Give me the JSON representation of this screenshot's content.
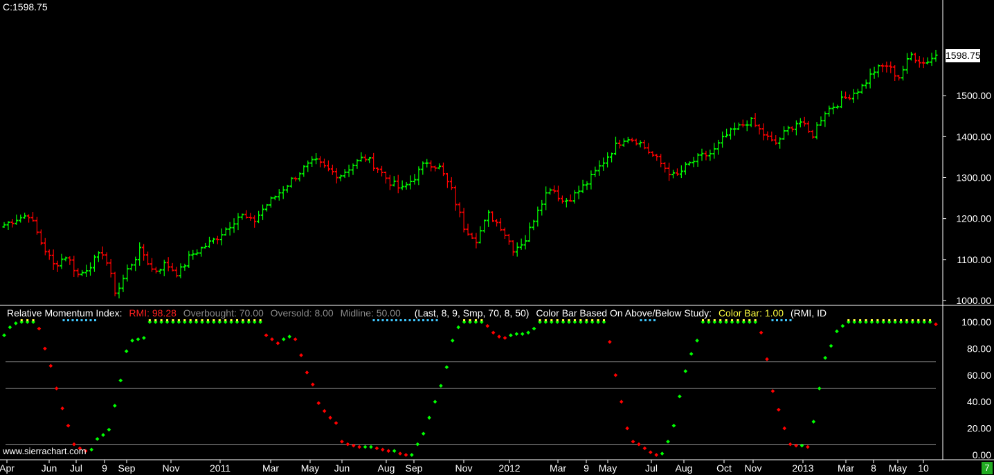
{
  "header": {
    "close_label": "C:1598.75"
  },
  "watermark": "www.sierrachart.com",
  "last_price_label": "1598.75",
  "corner_badge": "7",
  "study_header": {
    "name": "Relative Momentum Index:",
    "rmi": "RMI: 98.28",
    "overbought": "Overbought: 70.00",
    "oversold": "Oversold: 8.00",
    "midline": "Midline: 50.00",
    "params": "(Last, 8, 9, Smp, 70, 8, 50)",
    "color_bar_desc": "Color Bar Based On Above/Below Study:",
    "color_bar": "Color Bar: 1.00",
    "tail": "(RMI, ID"
  },
  "colors": {
    "up": "#00ff00",
    "down": "#ff0000",
    "grid": "#9a9a9a",
    "axis": "#ffffff",
    "marker_yellow": "#ffff40",
    "marker_cyan": "#40c8ff"
  },
  "chart_data": [
    {
      "type": "ohlc",
      "price_axis": {
        "min": 1000,
        "max": 1600,
        "ticks": [
          "1000.00",
          "1100.00",
          "1200.00",
          "1300.00",
          "1400.00",
          "1500.00"
        ]
      },
      "x_labels": [
        "Apr",
        "Jun",
        "Jul",
        "9",
        "Sep",
        "Nov",
        "2011",
        "Mar",
        "May",
        "Jun",
        "Aug",
        "Sep",
        "Nov",
        "2012",
        "Mar",
        "9",
        "May",
        "Jul",
        "Aug",
        "Oct",
        "Nov",
        "2013",
        "Mar",
        "8",
        "May",
        "10"
      ],
      "close_path": [
        1185,
        1200,
        1210,
        1140,
        1085,
        1110,
        1060,
        1090,
        1120,
        1015,
        1080,
        1125,
        1070,
        1090,
        1065,
        1110,
        1130,
        1150,
        1180,
        1210,
        1190,
        1230,
        1260,
        1290,
        1320,
        1340,
        1320,
        1305,
        1330,
        1350,
        1325,
        1290,
        1270,
        1300,
        1340,
        1325,
        1270,
        1180,
        1150,
        1210,
        1180,
        1125,
        1150,
        1230,
        1280,
        1240,
        1260,
        1290,
        1330,
        1370,
        1400,
        1390,
        1360,
        1330,
        1300,
        1330,
        1350,
        1360,
        1400,
        1420,
        1440,
        1410,
        1380,
        1415,
        1440,
        1400,
        1460,
        1480,
        1500,
        1520,
        1560,
        1575,
        1545,
        1600,
        1580,
        1598.75
      ]
    },
    {
      "type": "scatter",
      "name": "RMI",
      "y_axis": {
        "min": 0,
        "max": 100,
        "ticks": [
          "0.00",
          "20.00",
          "40.00",
          "60.00",
          "80.00",
          "100.00"
        ]
      },
      "levels": {
        "overbought": 70,
        "midline": 50,
        "oversold": 8
      },
      "values": [
        90,
        96,
        99,
        100,
        100,
        100,
        95,
        80,
        67,
        50,
        35,
        22,
        8,
        5,
        3,
        4,
        12,
        15,
        19,
        37,
        56,
        78,
        86,
        87,
        88,
        100,
        100,
        100,
        100,
        100,
        100,
        100,
        100,
        100,
        100,
        100,
        100,
        100,
        100,
        100,
        100,
        100,
        100,
        100,
        100,
        90,
        87,
        84,
        87,
        89,
        87,
        75,
        62,
        53,
        39,
        33,
        28,
        24,
        10,
        8,
        7,
        6,
        6,
        6,
        5,
        4,
        3,
        3,
        1,
        0,
        0,
        8,
        16,
        28,
        40,
        52,
        66,
        86,
        96,
        100,
        100,
        100,
        100,
        97,
        92,
        89,
        88,
        90,
        91,
        91,
        92,
        95,
        100,
        100,
        100,
        100,
        100,
        100,
        100,
        100,
        100,
        100,
        100,
        100,
        85,
        60,
        40,
        20,
        10,
        8,
        5,
        2,
        0,
        1,
        10,
        22,
        44,
        63,
        76,
        86,
        100,
        100,
        100,
        100,
        100,
        100,
        100,
        100,
        100,
        100,
        92,
        72,
        48,
        34,
        20,
        8,
        7,
        7,
        6,
        25,
        50,
        73,
        82,
        93,
        97,
        100,
        100,
        100,
        100,
        100,
        100,
        100,
        100,
        100,
        100,
        100,
        100,
        100,
        100,
        100,
        98.28
      ]
    }
  ]
}
